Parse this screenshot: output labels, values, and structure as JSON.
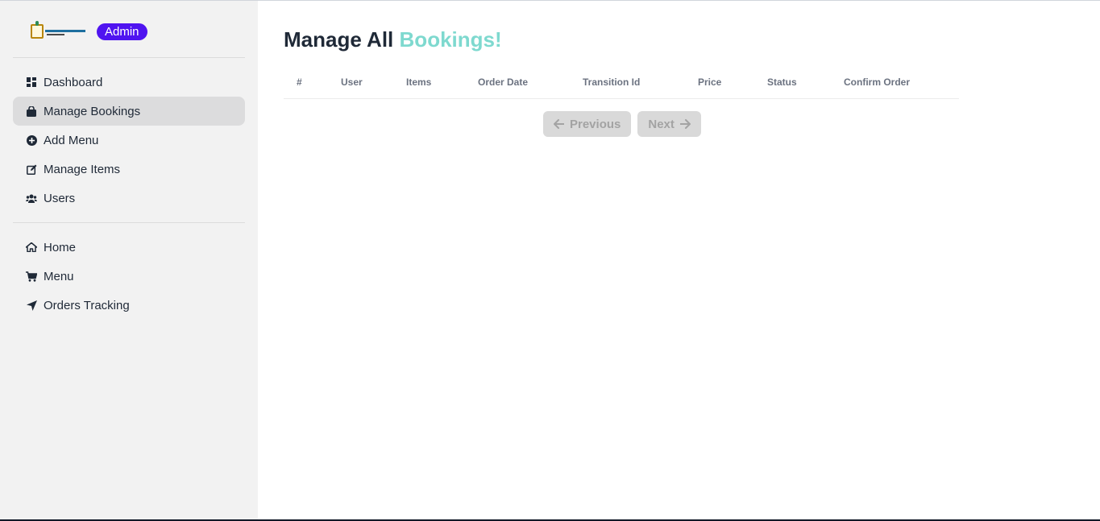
{
  "app": {
    "logo_icon": "restaurant-logo",
    "badge_label": "Admin",
    "accent_color": "#4f14f0"
  },
  "sidebar": {
    "admin_items": [
      {
        "label": "Dashboard",
        "icon": "dashboard-icon"
      },
      {
        "label": "Manage Bookings",
        "icon": "shopping-bag-icon",
        "active": true
      },
      {
        "label": "Add Menu",
        "icon": "plus-circle-icon"
      },
      {
        "label": "Manage Items",
        "icon": "edit-icon"
      },
      {
        "label": "Users",
        "icon": "users-icon"
      }
    ],
    "site_items": [
      {
        "label": "Home",
        "icon": "home-icon"
      },
      {
        "label": "Menu",
        "icon": "cart-icon"
      },
      {
        "label": "Orders Tracking",
        "icon": "location-arrow-icon"
      }
    ]
  },
  "page": {
    "title_main": "Manage All",
    "title_accent": "Bookings!",
    "title_accent_color": "#7ed9cf"
  },
  "table": {
    "columns": [
      "#",
      "User",
      "Items",
      "Order Date",
      "Transition Id",
      "Price",
      "Status",
      "Confirm Order"
    ],
    "rows": []
  },
  "pagination": {
    "previous_label": "Previous",
    "next_label": "Next"
  }
}
